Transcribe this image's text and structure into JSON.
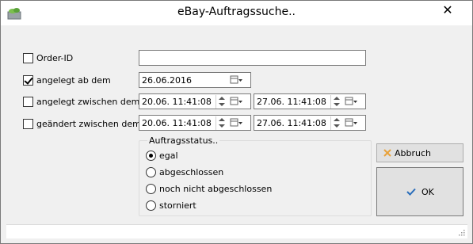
{
  "window": {
    "title": "eBay-Auftragssuche..",
    "close_glyph": "✕",
    "app_icon": "ebay-app-icon"
  },
  "filters": {
    "order_id": {
      "label": "Order-ID",
      "checked": false,
      "value": ""
    },
    "created_since": {
      "label": "angelegt ab dem",
      "checked": true,
      "date": "26.06.2016"
    },
    "created_between": {
      "label": "angelegt zwischen dem",
      "checked": false,
      "from": "20.06. 11:41:08",
      "to": "27.06. 11:41:08"
    },
    "changed_between": {
      "label": "geändert zwischen dem",
      "checked": false,
      "from": "20.06. 11:41:08",
      "to": "27.06. 11:41:08"
    }
  },
  "status_group": {
    "title": "Auftragsstatus..",
    "options": [
      {
        "label": "egal",
        "selected": true
      },
      {
        "label": "abgeschlossen",
        "selected": false
      },
      {
        "label": "noch nicht abgeschlossen",
        "selected": false
      },
      {
        "label": "storniert",
        "selected": false
      }
    ]
  },
  "buttons": {
    "cancel_label": "Abbruch",
    "cancel_icon": "x-icon",
    "ok_label": "OK",
    "ok_icon": "checkmark-icon"
  },
  "colors": {
    "cancel_icon": "#e8a23a",
    "ok_icon": "#2a6ebb"
  }
}
